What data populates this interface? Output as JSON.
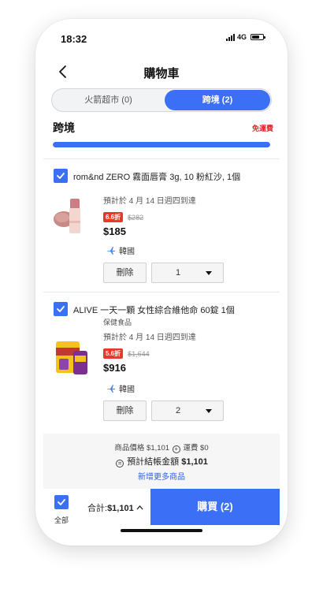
{
  "status": {
    "time": "18:32",
    "network": "4G"
  },
  "header": {
    "title": "購物車"
  },
  "tabs": [
    {
      "label": "火箭超市 (0)",
      "active": false
    },
    {
      "label": "跨境 (2)",
      "active": true
    }
  ],
  "section": {
    "title": "跨境",
    "shipping_label": "免運費",
    "progress_fraction": 1.0
  },
  "items": [
    {
      "name": "rom&nd ZERO 霧面唇膏 3g, 10 粉紅沙, 1個",
      "category": "",
      "delivery": "預計於 4 月 14 日週四到達",
      "discount_badge": "6.6折",
      "original_price": "$282",
      "price": "$185",
      "origin": "韓國",
      "delete_label": "刪除",
      "quantity": "1",
      "checked": true
    },
    {
      "name": "ALIVE 一天一顆 女性綜合維他命 60錠 1個",
      "category": "保健食品",
      "delivery": "預計於 4 月 14 日週四到達",
      "discount_badge": "5.6折",
      "original_price": "$1,644",
      "price": "$916",
      "origin": "韓國",
      "delete_label": "刪除",
      "quantity": "2",
      "checked": true
    }
  ],
  "summary": {
    "goods_label": "商品價格",
    "goods_value": "$1,101",
    "plus_symbol": "+",
    "shipping_label": "運費",
    "shipping_value": "$0",
    "equals_symbol": "=",
    "total_label": "預計結帳金額",
    "total_value": "$1,101",
    "add_more_link": "新增更多商品"
  },
  "footer": {
    "select_all_label": "全部",
    "total_prefix": "合計:",
    "total_value": "$1,101",
    "buy_button": "購買 (2)"
  },
  "colors": {
    "accent": "#3b6ff5",
    "discount": "#e23b2b",
    "free_shipping": "#e0242a"
  }
}
